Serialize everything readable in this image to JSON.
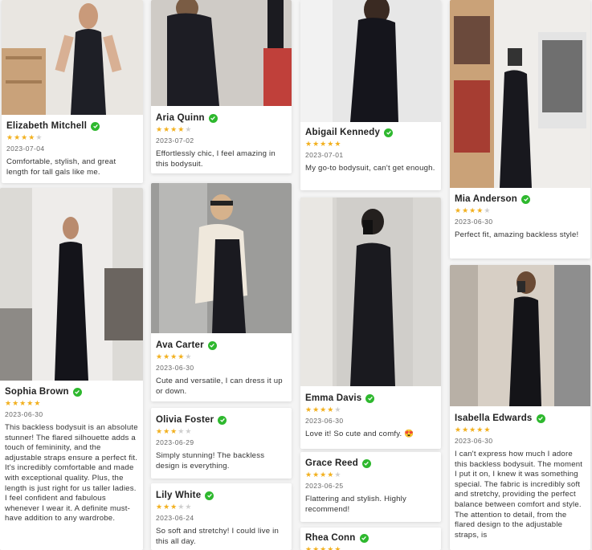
{
  "reviews": [
    {
      "name": "Elizabeth Mitchell",
      "rating": 4,
      "date": "2023-07-04",
      "text": "Comfortable, stylish, and great length for tall gals like me.",
      "verified": true
    },
    {
      "name": "Aria Quinn",
      "rating": 4,
      "date": "2023-07-02",
      "text": "Effortlessly chic, I feel amazing in this bodysuit.",
      "verified": true
    },
    {
      "name": "Abigail Kennedy",
      "rating": 5,
      "date": "2023-07-01",
      "text": "My go-to bodysuit, can't get enough.",
      "verified": true
    },
    {
      "name": "Mia Anderson",
      "rating": 4,
      "date": "2023-06-30",
      "text": "Perfect fit, amazing backless style!",
      "verified": true
    },
    {
      "name": "Sophia Brown",
      "rating": 5,
      "date": "2023-06-30",
      "text": "This backless bodysuit is an absolute stunner! The flared silhouette adds a touch of femininity, and the adjustable straps ensure a perfect fit. It's incredibly comfortable and made with exceptional quality. Plus, the length is just right for us taller ladies. I feel confident and fabulous whenever I wear it. A definite must-have addition to any wardrobe.",
      "verified": true
    },
    {
      "name": "Ava Carter",
      "rating": 4,
      "date": "2023-06-30",
      "text": "Cute and versatile, I can dress it up or down.",
      "verified": true
    },
    {
      "name": "Emma Davis",
      "rating": 4,
      "date": "2023-06-30",
      "text": "Love it! So cute and comfy. 😍",
      "verified": true
    },
    {
      "name": "Isabella Edwards",
      "rating": 5,
      "date": "2023-06-30",
      "text": "I can't express how much I adore this backless bodysuit. The moment I put it on, I knew it was something special. The fabric is incredibly soft and stretchy, providing the perfect balance between comfort and style. The attention to detail, from the flared design to the adjustable straps, is",
      "verified": true
    },
    {
      "name": "Olivia Foster",
      "rating": 3,
      "date": "2023-06-29",
      "text": "Simply stunning! The backless design is everything.",
      "verified": true
    },
    {
      "name": "Grace Reed",
      "rating": 4,
      "date": "2023-06-25",
      "text": "Flattering and stylish. Highly recommend!",
      "verified": true
    },
    {
      "name": "Lily White",
      "rating": 3,
      "date": "2023-06-24",
      "text": "So soft and stretchy! I could live in this all day.",
      "verified": true
    },
    {
      "name": "Rhea Conn",
      "rating": 5,
      "date": "",
      "text": "",
      "verified": true
    }
  ],
  "colors": {
    "star": "#f2b01e",
    "star_empty": "#cfcfcf",
    "verified": "#2eb82e"
  }
}
